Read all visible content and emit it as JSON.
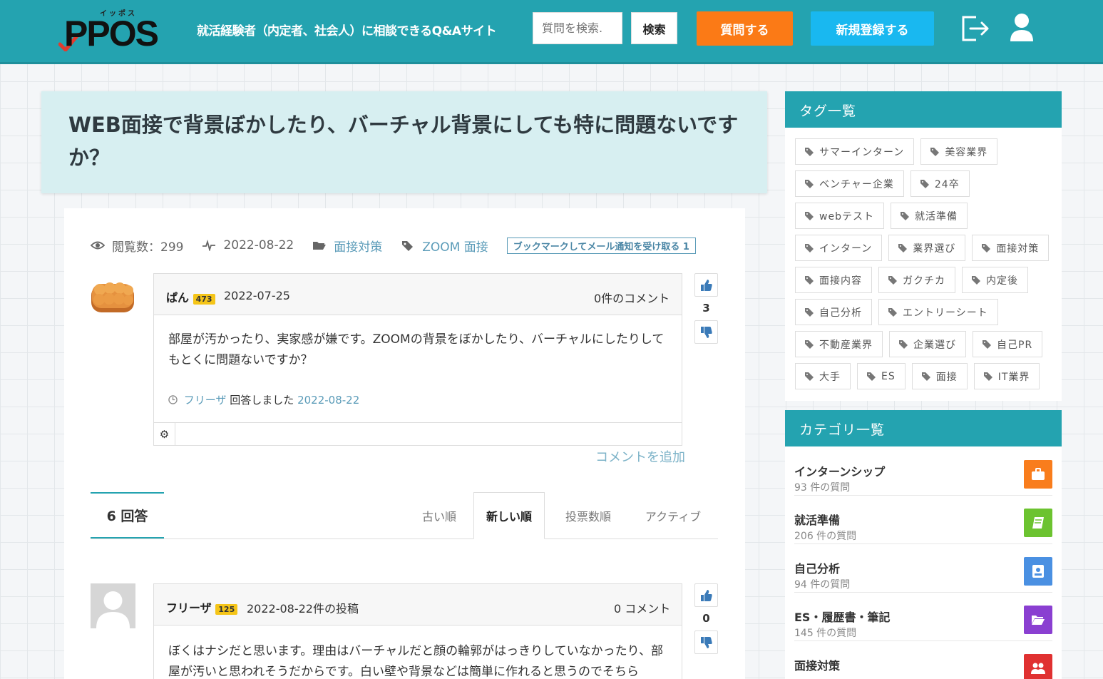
{
  "header": {
    "logo_ruby": "イッポス",
    "logo_text": "PPOS",
    "tagline": "就活経験者（内定者、社会人）に相談できるQ&Aサイト",
    "search_placeholder": "質問を検索.",
    "search_button": "検索",
    "ask_button": "質問する",
    "register_button": "新規登録する"
  },
  "question": {
    "title": "WEB面接で背景ぼかしたり、バーチャル背景にしても特に問題ないですか？",
    "views": "閲覧数：299",
    "date": "2022-08-22",
    "category": "面接対策",
    "tag": "ZOOM 面接",
    "bookmark": "ブックマークしてメール通知を受け取る 1",
    "author": "ぱん",
    "author_points": "473",
    "post_date": "2022-07-25",
    "comment_count": "0件のコメント",
    "body": "部屋が汚かったり、実家感が嫌です。ZOOMの背景をぼかしたり、バーチャルにしたりしてもとくに問題ないですか？",
    "answered_by": "フリーザ",
    "answered_text": "回答しました",
    "answered_date": "2022-08-22",
    "votes": "3",
    "add_comment": "コメントを追加"
  },
  "answers": {
    "count_label": "6 回答",
    "tabs": [
      "古い順",
      "新しい順",
      "投票数順",
      "アクティブ"
    ],
    "active_tab": "新しい順",
    "items": [
      {
        "author": "フリーザ",
        "points": "125",
        "date": "2022-08-22件の投稿",
        "comments": "0 コメント",
        "votes": "0",
        "body": "ぼくはナシだと思います。理由はバーチャルだと顔の輪郭がはっきりしていなかったり、部屋が汚いと思われそうだからです。白い壁や背景などは簡単に作れると思うのでそちら"
      }
    ]
  },
  "sidebar": {
    "tags_title": "タグ一覧",
    "tags": [
      "サマーインターン",
      "美容業界",
      "ベンチャー企業",
      "24卒",
      "webテスト",
      "就活準備",
      "インターン",
      "業界選び",
      "面接対策",
      "面接内容",
      "ガクチカ",
      "内定後",
      "自己分析",
      "エントリーシート",
      "不動産業界",
      "企業選び",
      "自己PR",
      "大手",
      "ES",
      "面接",
      "IT業界"
    ],
    "categories_title": "カテゴリ一覧",
    "categories": [
      {
        "name": "インターンシップ",
        "count": "93 件の質問",
        "color": "#f97d1c",
        "icon": "briefcase-icon"
      },
      {
        "name": "就活準備",
        "count": "206 件の質問",
        "color": "#6cc330",
        "icon": "book-icon"
      },
      {
        "name": "自己分析",
        "count": "94 件の質問",
        "color": "#4a90e2",
        "icon": "id-card-icon"
      },
      {
        "name": "ES・履歴書・筆記",
        "count": "145 件の質問",
        "color": "#8a3fd1",
        "icon": "folder-icon"
      },
      {
        "name": "面接対策",
        "count": "",
        "color": "#e03131",
        "icon": "users-icon"
      }
    ]
  }
}
